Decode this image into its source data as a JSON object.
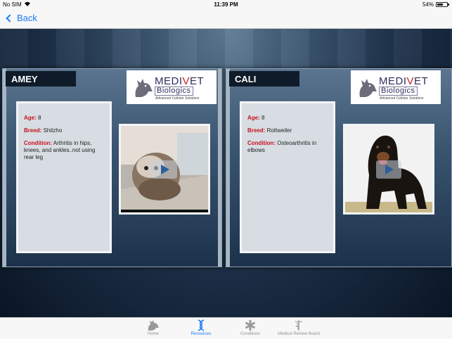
{
  "status_bar": {
    "carrier": "No SIM",
    "time": "11:39 PM",
    "battery": "54%",
    "battery_level": 0.54
  },
  "nav": {
    "back_label": "Back"
  },
  "cards": [
    {
      "name": "AMEY",
      "logo": {
        "medi": "MEDI",
        "v": "V",
        "et": "ET",
        "biologics": "Biologics",
        "tagline": "Advanced Cellular Solutions"
      },
      "age_label": "Age:",
      "age": "8",
      "breed_label": "Breed:",
      "breed": "Shitzho",
      "condition_label": "Condition:",
      "condition": "Arthritis in hips, knees, and ankles..not using rear leg"
    },
    {
      "name": "CALI",
      "logo": {
        "medi": "MEDI",
        "v": "V",
        "et": "ET",
        "biologics": "Biologics",
        "tagline": "Advanced Cellular Solutions"
      },
      "age_label": "Age:",
      "age": "8",
      "breed_label": "Breed:",
      "breed": "Rottweiler",
      "condition_label": "Condition:",
      "condition": "Osteoarthritis in elbows"
    }
  ],
  "tabs": [
    {
      "label": "Home",
      "icon": "dog-icon"
    },
    {
      "label": "Resources",
      "icon": "dna-icon",
      "active": true
    },
    {
      "label": "Conditions",
      "icon": "medical-star-icon"
    },
    {
      "label": "Medical Review Board",
      "icon": "caduceus-icon"
    }
  ],
  "colors": {
    "accent": "#1a7bf5",
    "label_red": "#c8121e"
  }
}
